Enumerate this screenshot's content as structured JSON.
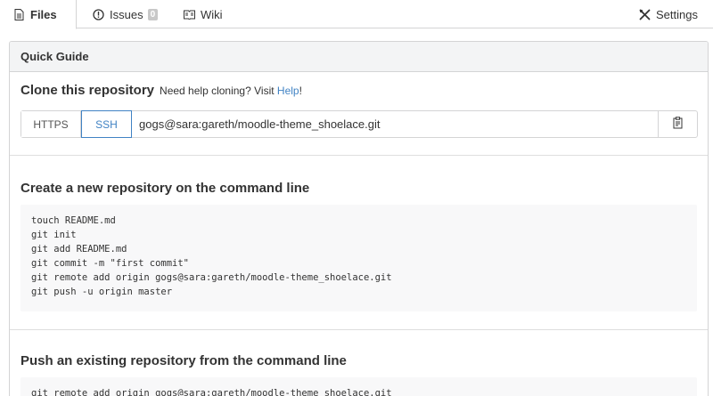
{
  "tabs": {
    "files": "Files",
    "issues": "Issues",
    "issues_count": "0",
    "wiki": "Wiki",
    "settings": "Settings"
  },
  "quick_guide": {
    "header": "Quick Guide",
    "clone": {
      "title": "Clone this repository",
      "help_prefix": "Need help cloning? Visit",
      "help_link": "Help",
      "help_suffix": "!",
      "https_label": "HTTPS",
      "ssh_label": "SSH",
      "url": "gogs@sara:gareth/moodle-theme_shoelace.git"
    },
    "new_repo": {
      "title": "Create a new repository on the command line",
      "commands": [
        "touch README.md",
        "git init",
        "git add README.md",
        "git commit -m \"first commit\"",
        "git remote add origin gogs@sara:gareth/moodle-theme_shoelace.git",
        "git push -u origin master"
      ]
    },
    "push_existing": {
      "title": "Push an existing repository from the command line",
      "commands": [
        "git remote add origin gogs@sara:gareth/moodle-theme_shoelace.git"
      ]
    }
  },
  "colors": {
    "link": "#4183c4",
    "border": "#d4d4d5",
    "header_bg": "#f3f4f5",
    "code_bg": "#f8f8f9"
  }
}
